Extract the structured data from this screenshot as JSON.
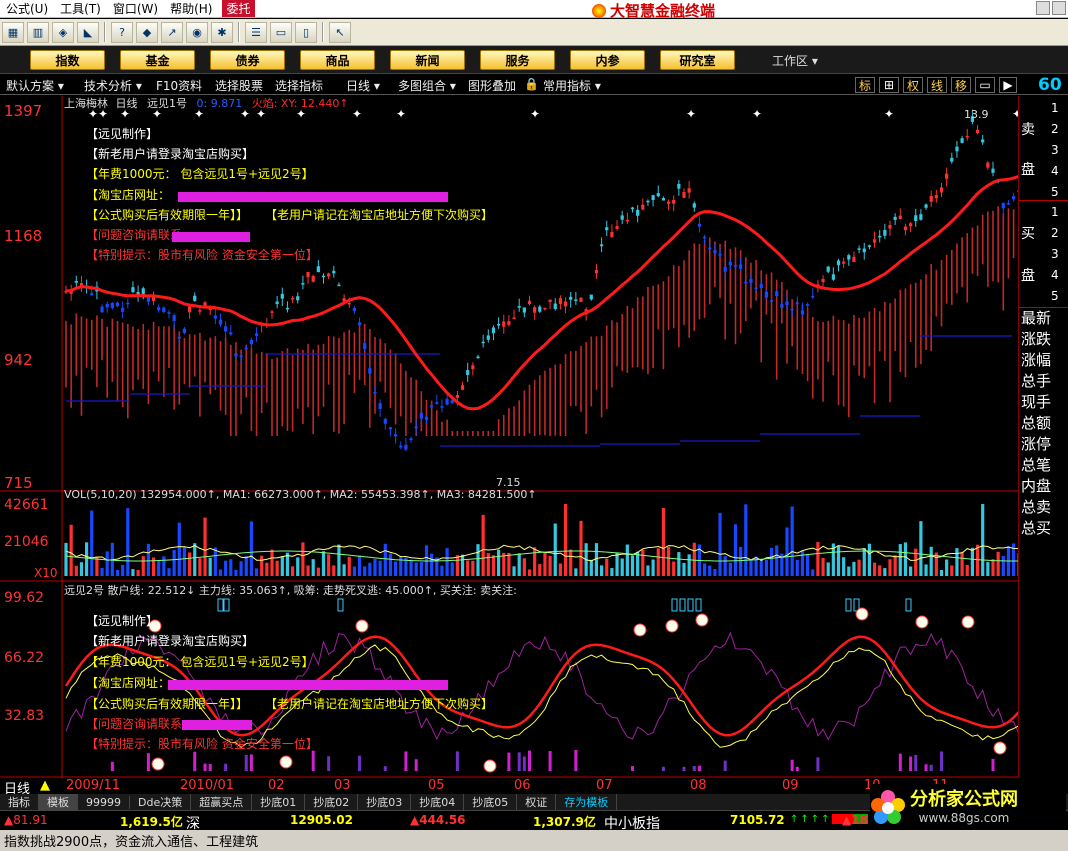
{
  "menu": {
    "items": [
      "公式(U)",
      "工具(T)",
      "窗口(W)",
      "帮助(H)"
    ],
    "weituo": "委托"
  },
  "brand": {
    "title": "大智慧金融终端"
  },
  "nav": {
    "buttons": [
      "指数",
      "基金",
      "债券",
      "商品",
      "新闻",
      "服务",
      "内参",
      "研究室"
    ],
    "workspace": "工作区"
  },
  "tabs2": {
    "items": [
      "默认方案",
      "技术分析",
      "F10资料",
      "选择股票",
      "选择指标",
      "日线",
      "多图组合",
      "图形叠加",
      "常用指标"
    ],
    "right": [
      "标",
      "权",
      "线",
      "移"
    ],
    "num": "60"
  },
  "main": {
    "header": {
      "name": "上海梅林",
      "period": "日线",
      "indicator": "远见1号",
      "v1": "0: 9.871",
      "v2": "火焰: XY: 12.440↑"
    },
    "yticks": [
      "1397",
      "1168",
      "942",
      "715"
    ],
    "high_label": "13.9",
    "low_label": "7.15",
    "notes": [
      "【远见制作】",
      "【新老用户请登录淘宝店购买】",
      "【年费1000元：  包含远见1号+远见2号】",
      "【淘宝店网址：",
      "【公式购买后有效期限一年】】",
      "【老用户请记在淘宝店地址方便下次购买】",
      "【问题咨询请联系",
      "【特别提示：股市有风险 资金安全第一位】"
    ]
  },
  "vol": {
    "header": "VOL(5,10,20) 132954.000↑, MA1: 66273.000↑, MA2: 55453.398↑, MA3: 84281.500↑",
    "yticks": [
      "42661",
      "21046",
      "X10"
    ]
  },
  "ind": {
    "header": "远见2号 散户线: 22.512↓  主力线: 35.063↑, 吸筹: 走势死叉逃: 45.000↑, 买关注: 卖关注:",
    "yticks": [
      "99.62",
      "66.22",
      "32.83"
    ]
  },
  "xaxis": {
    "period": "日线",
    "labels": [
      "2009/11",
      "2010/01",
      "02",
      "03",
      "05",
      "06",
      "07",
      "08",
      "09",
      "10",
      "11"
    ]
  },
  "right_panel": {
    "sell": [
      "卖",
      "盘"
    ],
    "sell_levels": [
      "1",
      "2",
      "3",
      "4",
      "5"
    ],
    "buy": [
      "买",
      "盘"
    ],
    "buy_levels": [
      "1",
      "2",
      "3",
      "4",
      "5"
    ],
    "fields": [
      "最新",
      "涨跌",
      "涨幅",
      "总手",
      "现手",
      "总额",
      "涨停",
      "总笔",
      "内盘",
      "总卖",
      "总买"
    ]
  },
  "bottom_tabs": [
    "指标",
    "模板",
    "99999",
    "Dde决策",
    "超赢买点",
    "抄底01",
    "抄底02",
    "抄底03",
    "抄底04",
    "抄底05",
    "权证",
    "存为模板"
  ],
  "ticker": {
    "a": "▲81.91",
    "b": "1,619.5亿",
    "c": "深",
    "d": "12905.02",
    "e": "▲444.56",
    "f": "1,307.9亿",
    "g": "中小板指",
    "h": "7105.72",
    "i": "▲18"
  },
  "status": {
    "text": "指数挑战2900点，资金流入通信、工程建筑"
  },
  "watermark": {
    "title": "分析家公式网",
    "url": "www.88gs.com"
  }
}
